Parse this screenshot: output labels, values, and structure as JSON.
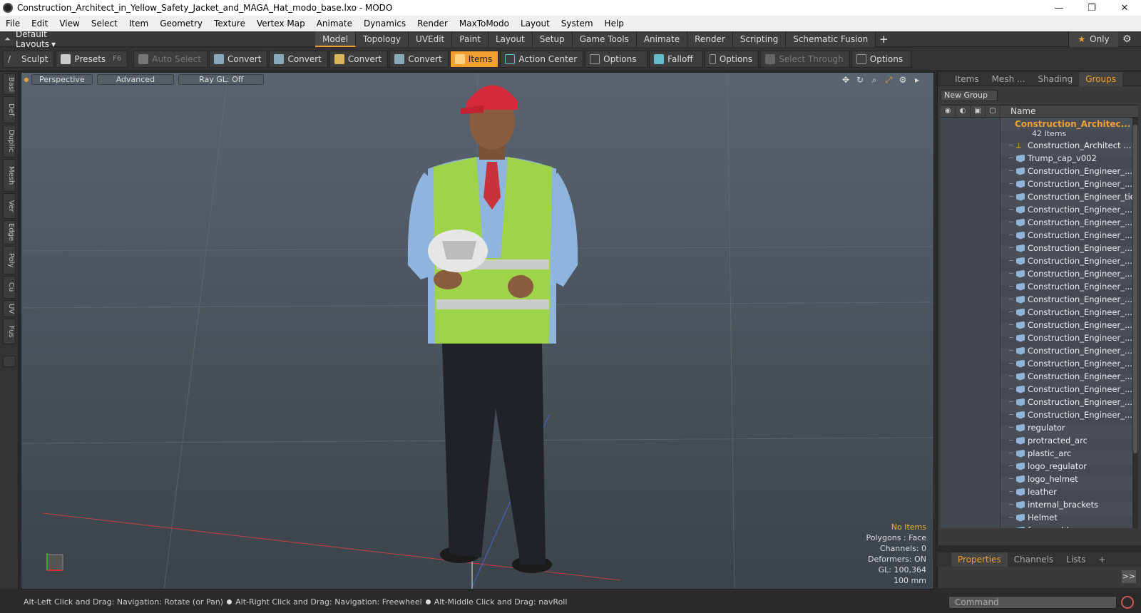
{
  "window": {
    "title": "Construction_Architect_in_Yellow_Safety_Jacket_and_MAGA_Hat_modo_base.lxo - MODO",
    "controls": [
      "—",
      "❐",
      "✕"
    ]
  },
  "menu": [
    "File",
    "Edit",
    "View",
    "Select",
    "Item",
    "Geometry",
    "Texture",
    "Vertex Map",
    "Animate",
    "Dynamics",
    "Render",
    "MaxToModo",
    "Layout",
    "System",
    "Help"
  ],
  "layouts": {
    "dropdown": "Default Layouts",
    "tabs": [
      "Model",
      "Topology",
      "UVEdit",
      "Paint",
      "Layout",
      "Setup",
      "Game Tools",
      "Animate",
      "Render",
      "Scripting",
      "Schematic Fusion"
    ],
    "active_tab": "Model",
    "only_label": "Only"
  },
  "toolbar": {
    "sculpt": "Sculpt",
    "presets": "Presets",
    "presets_key": "F6",
    "auto_select": "Auto Select",
    "convert1": "Convert",
    "convert2": "Convert",
    "convert3": "Convert",
    "convert4": "Convert",
    "items": "Items",
    "action_center": "Action Center",
    "options1": "Options",
    "falloff": "Falloff",
    "options2": "Options",
    "select_through": "Select Through",
    "options3": "Options"
  },
  "left_tabs": [
    "Basi",
    "Def",
    "Duplic",
    "Mesh",
    "Ver",
    "Edge",
    "Poly",
    "Cu",
    "UV",
    "Fus"
  ],
  "viewport": {
    "view": "Perspective",
    "mode": "Advanced",
    "raygl": "Ray GL: Off",
    "info": {
      "selection": "No Items",
      "polygons": "Polygons : Face",
      "channels": "Channels: 0",
      "deformers": "Deformers: ON",
      "gl": "GL: 100,364",
      "scale": "100 mm"
    }
  },
  "status": {
    "hint1": "Alt-Left Click and Drag: Navigation: Rotate (or Pan)",
    "hint2": "Alt-Right Click and Drag: Navigation: Freewheel",
    "hint3": "Alt-Middle Click and Drag: navRoll"
  },
  "right_panel": {
    "tabs": [
      "Items",
      "Mesh ...",
      "Shading",
      "Groups"
    ],
    "active_tab": "Groups",
    "new_group": "New Group",
    "name_header": "Name",
    "group": {
      "title": "Construction_Architec...",
      "count": "42 Items"
    },
    "items": [
      "Construction_Architect ...",
      "Trump_cap_v002",
      "Construction_Engineer_...",
      "Construction_Engineer_...",
      "Construction_Engineer_tie",
      "Construction_Engineer_...",
      "Construction_Engineer_...",
      "Construction_Engineer_...",
      "Construction_Engineer_...",
      "Construction_Engineer_...",
      "Construction_Engineer_...",
      "Construction_Engineer_...",
      "Construction_Engineer_...",
      "Construction_Engineer_...",
      "Construction_Engineer_...",
      "Construction_Engineer_...",
      "Construction_Engineer_...",
      "Construction_Engineer_...",
      "Construction_Engineer_...",
      "Construction_Engineer_...",
      "Construction_Engineer_...",
      "Construction_Engineer_...",
      "regulator",
      "protracted_arc",
      "plastic_arc",
      "logo_regulator",
      "logo_helmet",
      "leather",
      "internal_brackets",
      "Helmet",
      "foam_rubber"
    ],
    "bottom_tabs": [
      "Properties",
      "Channels",
      "Lists"
    ],
    "bottom_active": "Properties",
    "expand": ">>",
    "command_placeholder": "Command"
  },
  "colors": {
    "accent": "#f0a030",
    "viewport_top": "#5a6470",
    "viewport_bottom": "#3c434a"
  }
}
